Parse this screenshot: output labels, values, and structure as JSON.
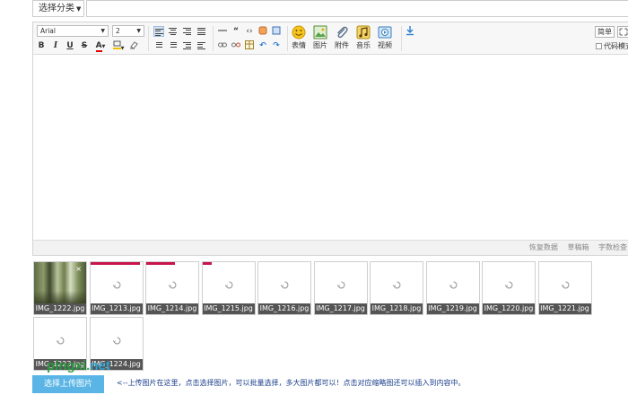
{
  "topbar": {
    "category_label": "选择分类",
    "title_value": ""
  },
  "toolbar": {
    "font_family": "Arial",
    "font_size": "2",
    "bold": "B",
    "italic": "I",
    "underline": "U",
    "strike": "S",
    "font_color": "A",
    "emoticon_label": "表情",
    "image_label": "图片",
    "attach_label": "附件",
    "music_label": "音乐",
    "video_label": "视频",
    "simple_mode_label": "简单",
    "code_mode_label": "代码模式"
  },
  "statusbar": {
    "restore_data": "恢复数据",
    "draft_box": "草稿箱",
    "word_check": "字数检查"
  },
  "attachments": [
    {
      "name": "IMG_1222.jpg",
      "state": "loaded",
      "progress": null
    },
    {
      "name": "IMG_1213.jpg",
      "state": "uploading",
      "progress": 0.95
    },
    {
      "name": "IMG_1214.jpg",
      "state": "uploading",
      "progress": 0.55
    },
    {
      "name": "IMG_1215.jpg",
      "state": "uploading",
      "progress": 0.17
    },
    {
      "name": "IMG_1216.jpg",
      "state": "pending",
      "progress": 0
    },
    {
      "name": "IMG_1217.jpg",
      "state": "pending",
      "progress": 0
    },
    {
      "name": "IMG_1218.jpg",
      "state": "pending",
      "progress": 0
    },
    {
      "name": "IMG_1219.jpg",
      "state": "pending",
      "progress": 0
    },
    {
      "name": "IMG_1220.jpg",
      "state": "pending",
      "progress": 0
    },
    {
      "name": "IMG_1221.jpg",
      "state": "pending",
      "progress": 0
    },
    {
      "name": "IMG_1223.jpg",
      "state": "pending",
      "progress": 0
    },
    {
      "name": "IMG_1224.jpg",
      "state": "pending",
      "progress": 0
    }
  ],
  "upload": {
    "button_label": "选择上传图片",
    "hint": "<--上传图片在这里，点击选择图片，可以批量选择，多大图片都可以！点击对应缩略图还可以插入到内容中。"
  },
  "watermark": {
    "prefix": "pingxi.",
    "suffix": "net"
  },
  "colors": {
    "progress_bar": "#c8144a",
    "upload_button": "#5ab5e6",
    "hint_text": "#1a3e8a",
    "thumb_caption_bg": "#555555"
  }
}
